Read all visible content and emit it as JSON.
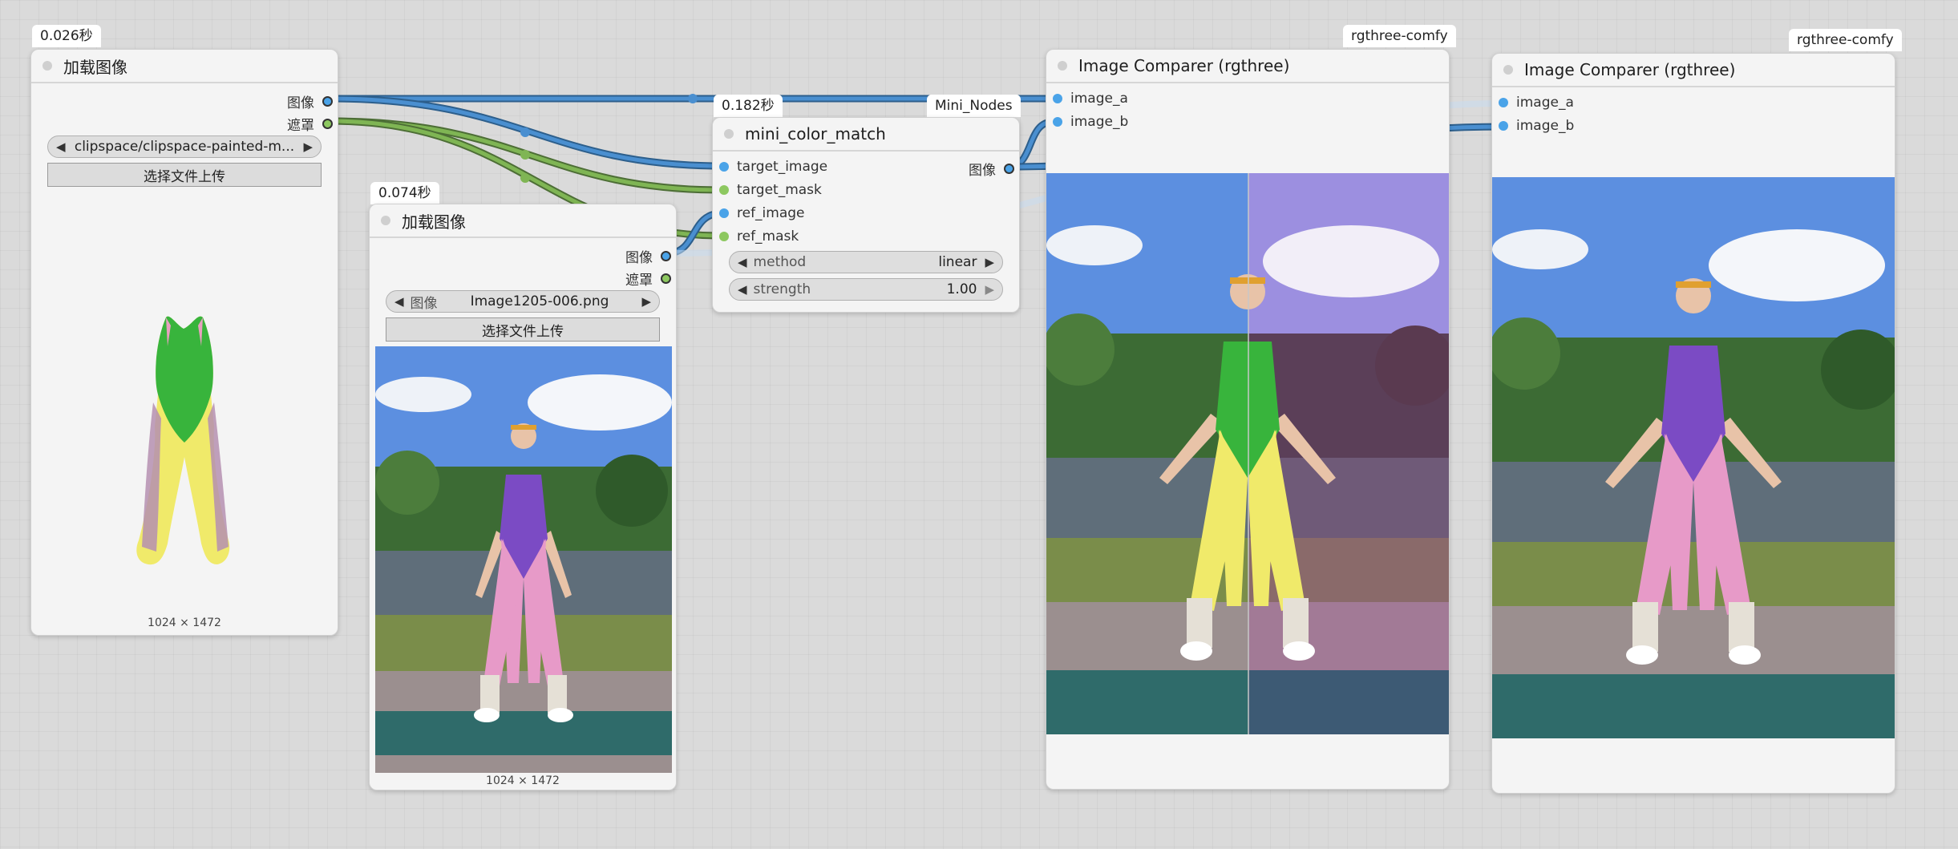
{
  "load_image_1": {
    "timing": "0.026秒",
    "title": "加载图像",
    "outputs": [
      "图像",
      "遮罩"
    ],
    "file_value": "clipspace/clipspace-painted-m...",
    "upload_button": "选择文件上传",
    "dimensions": "1024 × 1472"
  },
  "load_image_2": {
    "timing": "0.074秒",
    "title": "加载图像",
    "outputs": [
      "图像",
      "遮罩"
    ],
    "file_label": "图像",
    "file_value": "Image1205-006.png",
    "upload_button": "选择文件上传",
    "dimensions": "1024 × 1472"
  },
  "color_match": {
    "timing": "0.182秒",
    "source_badge": "Mini_Nodes",
    "title": "mini_color_match",
    "inputs": [
      "target_image",
      "target_mask",
      "ref_image",
      "ref_mask"
    ],
    "output": "图像",
    "method_label": "method",
    "method_value": "linear",
    "strength_label": "strength",
    "strength_value": "1.00"
  },
  "comparer_1": {
    "source_badge": "rgthree-comfy",
    "title": "Image Comparer (rgthree)",
    "inputs": [
      "image_a",
      "image_b"
    ]
  },
  "comparer_2": {
    "source_badge": "rgthree-comfy",
    "title": "Image Comparer (rgthree)",
    "inputs": [
      "image_a",
      "image_b"
    ]
  },
  "colors": {
    "image_wire": "#4a8fd0",
    "mask_wire": "#7fb554",
    "suit_green": "#38b43c",
    "suit_purple": "#7b4bc4",
    "tights_yellow": "#f0ea6a",
    "tights_pink": "#e79ac8"
  }
}
